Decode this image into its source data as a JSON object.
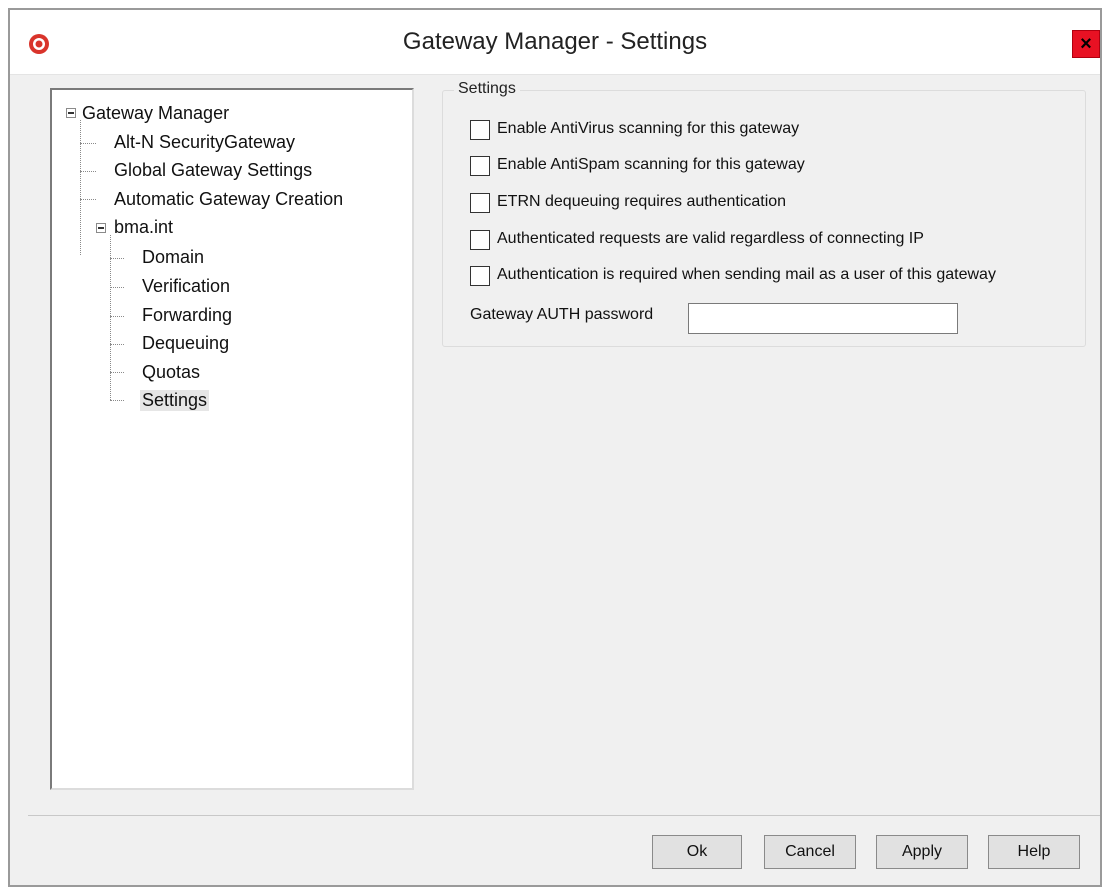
{
  "window": {
    "title": "Gateway Manager - Settings",
    "close_label": "×"
  },
  "tree": {
    "items": [
      {
        "label": "Gateway Manager"
      },
      {
        "label": "Alt-N SecurityGateway"
      },
      {
        "label": "Global Gateway Settings"
      },
      {
        "label": "Automatic Gateway Creation"
      },
      {
        "label": "bma.int"
      },
      {
        "label": "Domain"
      },
      {
        "label": "Verification"
      },
      {
        "label": "Forwarding"
      },
      {
        "label": "Dequeuing"
      },
      {
        "label": "Quotas"
      },
      {
        "label": "Settings",
        "selected": true
      }
    ]
  },
  "settings": {
    "group_label": "Settings",
    "options": [
      {
        "label": "Enable AntiVirus scanning for this gateway",
        "checked": false
      },
      {
        "label": "Enable AntiSpam scanning for this gateway",
        "checked": false
      },
      {
        "label": "ETRN dequeuing requires authentication",
        "checked": false
      },
      {
        "label": "Authenticated requests are valid regardless of connecting IP",
        "checked": false
      },
      {
        "label": "Authentication is required when sending mail as a user of this gateway",
        "checked": false
      }
    ],
    "auth_password_label": "Gateway AUTH password",
    "auth_password_value": ""
  },
  "buttons": {
    "ok": "Ok",
    "cancel": "Cancel",
    "apply": "Apply",
    "help": "Help"
  },
  "colors": {
    "close_button": "#e81123",
    "window_bg": "#f0f0f0"
  }
}
